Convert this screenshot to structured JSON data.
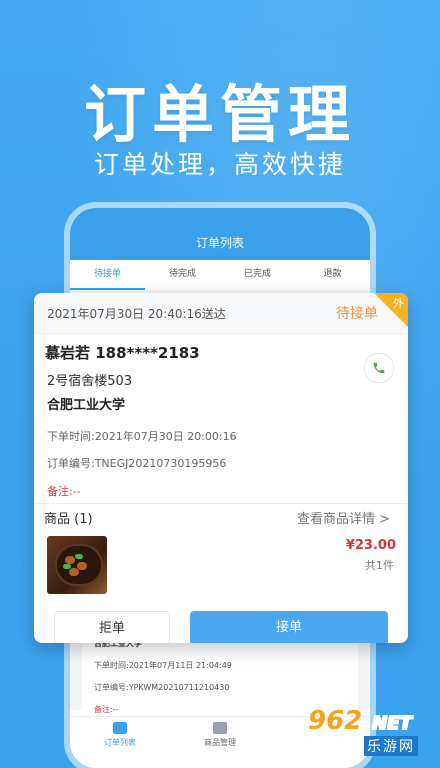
{
  "promo": {
    "headline": "订单管理",
    "subheadline": "订单处理，高效快捷"
  },
  "phone": {
    "header_title": "订单列表",
    "tabs": [
      {
        "label": "待接单",
        "active": true
      },
      {
        "label": "待完成",
        "active": false
      },
      {
        "label": "已完成",
        "active": false
      },
      {
        "label": "退款",
        "active": false
      }
    ],
    "back_card": {
      "school_partial": "合肥工业大学",
      "order_time": "下单时间:2021年07月11日 21:04:49",
      "order_no": "订单编号:YPKWM20210711210430",
      "note": "备注:--"
    },
    "bottom_nav": [
      {
        "label": "订单列表",
        "icon": "order-list-icon",
        "active": true
      },
      {
        "label": "商品管理",
        "icon": "goods-manage-icon",
        "active": false
      }
    ]
  },
  "order_card": {
    "delivery_time": "2021年07月30日 20:40:16送达",
    "status": "待接单",
    "corner_tag": "外",
    "customer": "慕岩若  188****2183",
    "address": "2号宿舍楼503",
    "school": "合肥工业大学",
    "order_time": "下单时间:2021年07月30日 20:00:16",
    "order_no": "订单编号:TNEGJ20210730195956",
    "note": "备注:--",
    "goods_label": "商品 (1)",
    "goods_detail_link": "查看商品详情 >",
    "price": "¥23.00",
    "quantity": "共1件",
    "reject_label": "拒单",
    "accept_label": "接单"
  },
  "watermark": {
    "number": "962",
    "dot": ".",
    "net": "NET",
    "sub": "乐游网"
  },
  "colors": {
    "background": "#3aa3ee",
    "accent": "#3aa0ea",
    "status": "#f0903a",
    "price": "#dd3333"
  }
}
